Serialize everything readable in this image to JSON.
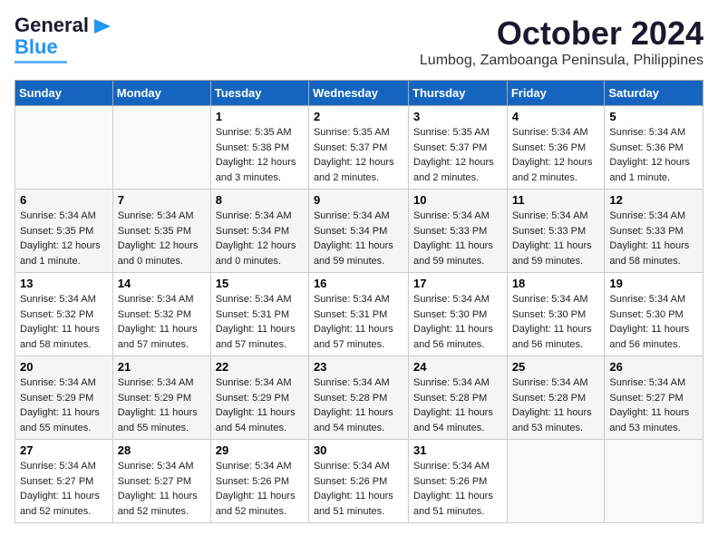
{
  "header": {
    "logo_line1": "General",
    "logo_line2": "Blue",
    "title": "October 2024",
    "subtitle": "Lumbog, Zamboanga Peninsula, Philippines"
  },
  "days_of_week": [
    "Sunday",
    "Monday",
    "Tuesday",
    "Wednesday",
    "Thursday",
    "Friday",
    "Saturday"
  ],
  "weeks": [
    [
      {
        "day": "",
        "detail": ""
      },
      {
        "day": "",
        "detail": ""
      },
      {
        "day": "1",
        "detail": "Sunrise: 5:35 AM\nSunset: 5:38 PM\nDaylight: 12 hours\nand 3 minutes."
      },
      {
        "day": "2",
        "detail": "Sunrise: 5:35 AM\nSunset: 5:37 PM\nDaylight: 12 hours\nand 2 minutes."
      },
      {
        "day": "3",
        "detail": "Sunrise: 5:35 AM\nSunset: 5:37 PM\nDaylight: 12 hours\nand 2 minutes."
      },
      {
        "day": "4",
        "detail": "Sunrise: 5:34 AM\nSunset: 5:36 PM\nDaylight: 12 hours\nand 2 minutes."
      },
      {
        "day": "5",
        "detail": "Sunrise: 5:34 AM\nSunset: 5:36 PM\nDaylight: 12 hours\nand 1 minute."
      }
    ],
    [
      {
        "day": "6",
        "detail": "Sunrise: 5:34 AM\nSunset: 5:35 PM\nDaylight: 12 hours\nand 1 minute."
      },
      {
        "day": "7",
        "detail": "Sunrise: 5:34 AM\nSunset: 5:35 PM\nDaylight: 12 hours\nand 0 minutes."
      },
      {
        "day": "8",
        "detail": "Sunrise: 5:34 AM\nSunset: 5:34 PM\nDaylight: 12 hours\nand 0 minutes."
      },
      {
        "day": "9",
        "detail": "Sunrise: 5:34 AM\nSunset: 5:34 PM\nDaylight: 11 hours\nand 59 minutes."
      },
      {
        "day": "10",
        "detail": "Sunrise: 5:34 AM\nSunset: 5:33 PM\nDaylight: 11 hours\nand 59 minutes."
      },
      {
        "day": "11",
        "detail": "Sunrise: 5:34 AM\nSunset: 5:33 PM\nDaylight: 11 hours\nand 59 minutes."
      },
      {
        "day": "12",
        "detail": "Sunrise: 5:34 AM\nSunset: 5:33 PM\nDaylight: 11 hours\nand 58 minutes."
      }
    ],
    [
      {
        "day": "13",
        "detail": "Sunrise: 5:34 AM\nSunset: 5:32 PM\nDaylight: 11 hours\nand 58 minutes."
      },
      {
        "day": "14",
        "detail": "Sunrise: 5:34 AM\nSunset: 5:32 PM\nDaylight: 11 hours\nand 57 minutes."
      },
      {
        "day": "15",
        "detail": "Sunrise: 5:34 AM\nSunset: 5:31 PM\nDaylight: 11 hours\nand 57 minutes."
      },
      {
        "day": "16",
        "detail": "Sunrise: 5:34 AM\nSunset: 5:31 PM\nDaylight: 11 hours\nand 57 minutes."
      },
      {
        "day": "17",
        "detail": "Sunrise: 5:34 AM\nSunset: 5:30 PM\nDaylight: 11 hours\nand 56 minutes."
      },
      {
        "day": "18",
        "detail": "Sunrise: 5:34 AM\nSunset: 5:30 PM\nDaylight: 11 hours\nand 56 minutes."
      },
      {
        "day": "19",
        "detail": "Sunrise: 5:34 AM\nSunset: 5:30 PM\nDaylight: 11 hours\nand 56 minutes."
      }
    ],
    [
      {
        "day": "20",
        "detail": "Sunrise: 5:34 AM\nSunset: 5:29 PM\nDaylight: 11 hours\nand 55 minutes."
      },
      {
        "day": "21",
        "detail": "Sunrise: 5:34 AM\nSunset: 5:29 PM\nDaylight: 11 hours\nand 55 minutes."
      },
      {
        "day": "22",
        "detail": "Sunrise: 5:34 AM\nSunset: 5:29 PM\nDaylight: 11 hours\nand 54 minutes."
      },
      {
        "day": "23",
        "detail": "Sunrise: 5:34 AM\nSunset: 5:28 PM\nDaylight: 11 hours\nand 54 minutes."
      },
      {
        "day": "24",
        "detail": "Sunrise: 5:34 AM\nSunset: 5:28 PM\nDaylight: 11 hours\nand 54 minutes."
      },
      {
        "day": "25",
        "detail": "Sunrise: 5:34 AM\nSunset: 5:28 PM\nDaylight: 11 hours\nand 53 minutes."
      },
      {
        "day": "26",
        "detail": "Sunrise: 5:34 AM\nSunset: 5:27 PM\nDaylight: 11 hours\nand 53 minutes."
      }
    ],
    [
      {
        "day": "27",
        "detail": "Sunrise: 5:34 AM\nSunset: 5:27 PM\nDaylight: 11 hours\nand 52 minutes."
      },
      {
        "day": "28",
        "detail": "Sunrise: 5:34 AM\nSunset: 5:27 PM\nDaylight: 11 hours\nand 52 minutes."
      },
      {
        "day": "29",
        "detail": "Sunrise: 5:34 AM\nSunset: 5:26 PM\nDaylight: 11 hours\nand 52 minutes."
      },
      {
        "day": "30",
        "detail": "Sunrise: 5:34 AM\nSunset: 5:26 PM\nDaylight: 11 hours\nand 51 minutes."
      },
      {
        "day": "31",
        "detail": "Sunrise: 5:34 AM\nSunset: 5:26 PM\nDaylight: 11 hours\nand 51 minutes."
      },
      {
        "day": "",
        "detail": ""
      },
      {
        "day": "",
        "detail": ""
      }
    ]
  ]
}
